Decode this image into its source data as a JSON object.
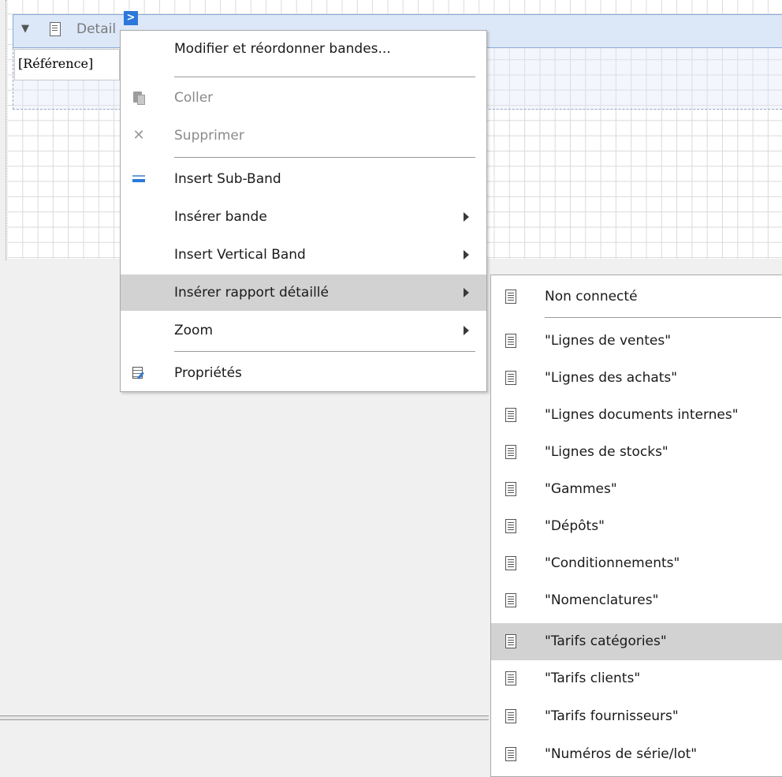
{
  "band": {
    "title": "Detail",
    "field": "[Référence]",
    "smart_tag": ">"
  },
  "context_menu": {
    "items": [
      {
        "label": "Modifier et réordonner bandes...",
        "icon": "",
        "disabled": false,
        "submenu": false
      },
      {
        "label": "Coller",
        "icon": "paste-icon",
        "disabled": true,
        "submenu": false
      },
      {
        "label": "Supprimer",
        "icon": "delete-icon",
        "disabled": true,
        "submenu": false
      },
      {
        "label": "Insert Sub-Band",
        "icon": "sub-band-icon",
        "disabled": false,
        "submenu": false
      },
      {
        "label": "Insérer bande",
        "icon": "",
        "disabled": false,
        "submenu": true
      },
      {
        "label": "Insert Vertical Band",
        "icon": "",
        "disabled": false,
        "submenu": true
      },
      {
        "label": "Insérer rapport détaillé",
        "icon": "",
        "disabled": false,
        "submenu": true,
        "highlighted": true
      },
      {
        "label": "Zoom",
        "icon": "",
        "disabled": false,
        "submenu": true
      },
      {
        "label": "Propriétés",
        "icon": "properties-icon",
        "disabled": false,
        "submenu": false
      }
    ]
  },
  "submenu": {
    "items": [
      {
        "label": "Non connecté",
        "icon": "report-icon"
      },
      {
        "label": "\"Lignes de ventes\"",
        "icon": "report-icon"
      },
      {
        "label": "\"Lignes des achats\"",
        "icon": "report-icon"
      },
      {
        "label": "\"Lignes documents internes\"",
        "icon": "report-icon"
      },
      {
        "label": "\"Lignes de stocks\"",
        "icon": "report-icon"
      },
      {
        "label": "\"Gammes\"",
        "icon": "report-icon"
      },
      {
        "label": "\"Dépôts\"",
        "icon": "report-icon"
      },
      {
        "label": "\"Conditionnements\"",
        "icon": "report-icon"
      },
      {
        "label": "\"Nomenclatures\"",
        "icon": "report-icon"
      },
      {
        "label": "\"Tarifs catégories\"",
        "icon": "report-icon",
        "highlighted": true
      },
      {
        "label": "\"Tarifs clients\"",
        "icon": "report-icon"
      },
      {
        "label": "\"Tarifs fournisseurs\"",
        "icon": "report-icon"
      },
      {
        "label": "\"Numéros de série/lot\"",
        "icon": "report-icon"
      }
    ]
  }
}
